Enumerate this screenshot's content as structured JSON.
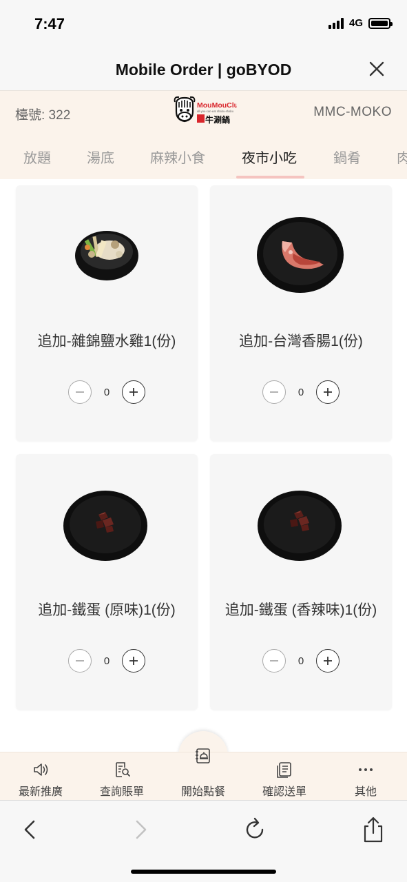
{
  "status_bar": {
    "time": "7:47",
    "network": "4G",
    "battery_level": 1.0
  },
  "title_bar": {
    "title": "Mobile Order | goBYOD",
    "close_icon": "close-icon"
  },
  "header": {
    "table_label": "檯號: 322",
    "logo": {
      "brand": "MouMouClub",
      "tagline": "all-you-can-eat shabu-shabu",
      "name_cn": "牛涮鍋"
    },
    "store_code": "MMC-MOKO"
  },
  "tabs": [
    {
      "label": "放題",
      "active": false
    },
    {
      "label": "湯底",
      "active": false
    },
    {
      "label": "麻辣小食",
      "active": false
    },
    {
      "label": "夜市小吃",
      "active": true
    },
    {
      "label": "鍋肴",
      "active": false
    },
    {
      "label": "肉",
      "active": false
    }
  ],
  "items": [
    {
      "name": "追加-雜錦鹽水雞1(份)",
      "qty": "0",
      "image": "salt-water-chicken-bowl"
    },
    {
      "name": "追加-台灣香腸1(份)",
      "qty": "0",
      "image": "taiwan-sausage-plate"
    },
    {
      "name": "追加-鐵蛋 (原味)1(份)",
      "qty": "0",
      "image": "iron-egg-plate"
    },
    {
      "name": "追加-鐵蛋 (香辣味)1(份)",
      "qty": "0",
      "image": "spicy-iron-egg-plate"
    }
  ],
  "bottom_nav": [
    {
      "label": "最新推廣",
      "icon": "speaker-icon"
    },
    {
      "label": "查詢賬單",
      "icon": "search-bill-icon"
    },
    {
      "label": "開始點餐",
      "icon": "order-bell-icon"
    },
    {
      "label": "確認送單",
      "icon": "confirm-order-icon"
    },
    {
      "label": "其他",
      "icon": "more-icon"
    }
  ],
  "safari_toolbar": [
    "back-icon",
    "forward-icon",
    "reload-icon",
    "share-icon"
  ],
  "colors": {
    "header_bg": "#fbf3eb",
    "tab_active_underline": "#f5c4c0",
    "card_bg": "#f6f6f6",
    "logo_red": "#d9262c"
  }
}
